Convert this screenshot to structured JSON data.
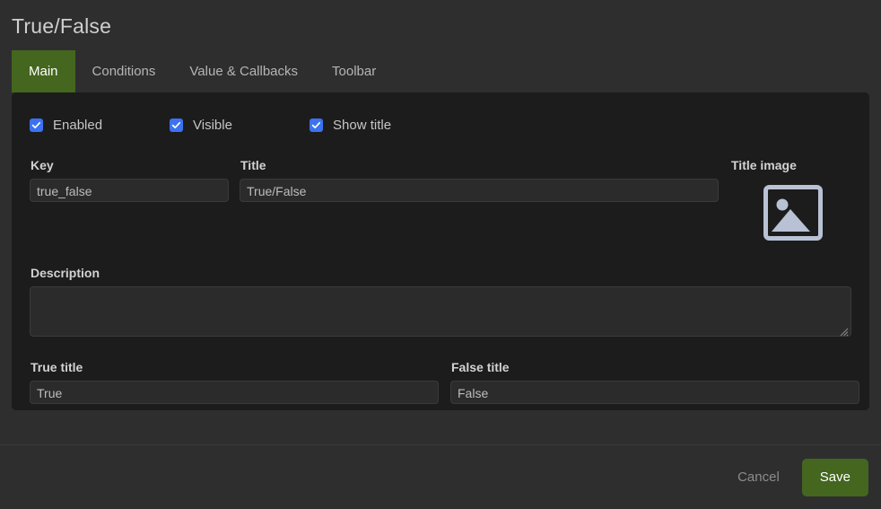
{
  "header": {
    "title": "True/False"
  },
  "tabs": [
    {
      "label": "Main",
      "active": true
    },
    {
      "label": "Conditions",
      "active": false
    },
    {
      "label": "Value & Callbacks",
      "active": false
    },
    {
      "label": "Toolbar",
      "active": false
    }
  ],
  "main": {
    "checkboxes": [
      {
        "label": "Enabled",
        "checked": true
      },
      {
        "label": "Visible",
        "checked": true
      },
      {
        "label": "Show title",
        "checked": true
      }
    ],
    "key": {
      "label": "Key",
      "value": "true_false",
      "placeholder": ""
    },
    "title": {
      "label": "Title",
      "value": "True/False",
      "placeholder": ""
    },
    "title_image": {
      "label": "Title image",
      "icon": "image-placeholder-icon"
    },
    "description": {
      "label": "Description",
      "value": "",
      "placeholder": ""
    },
    "true_title": {
      "label": "True title",
      "value": "True",
      "placeholder": ""
    },
    "false_title": {
      "label": "False title",
      "value": "False",
      "placeholder": ""
    }
  },
  "footer": {
    "cancel_label": "Cancel",
    "save_label": "Save"
  },
  "colors": {
    "page_background": "#2e2e2e",
    "panel_background": "#1c1c1c",
    "accent_green": "#44661f",
    "checkbox_blue": "#3b72f0",
    "input_background": "#2b2b2b",
    "image_icon": "#b8c2d4"
  }
}
